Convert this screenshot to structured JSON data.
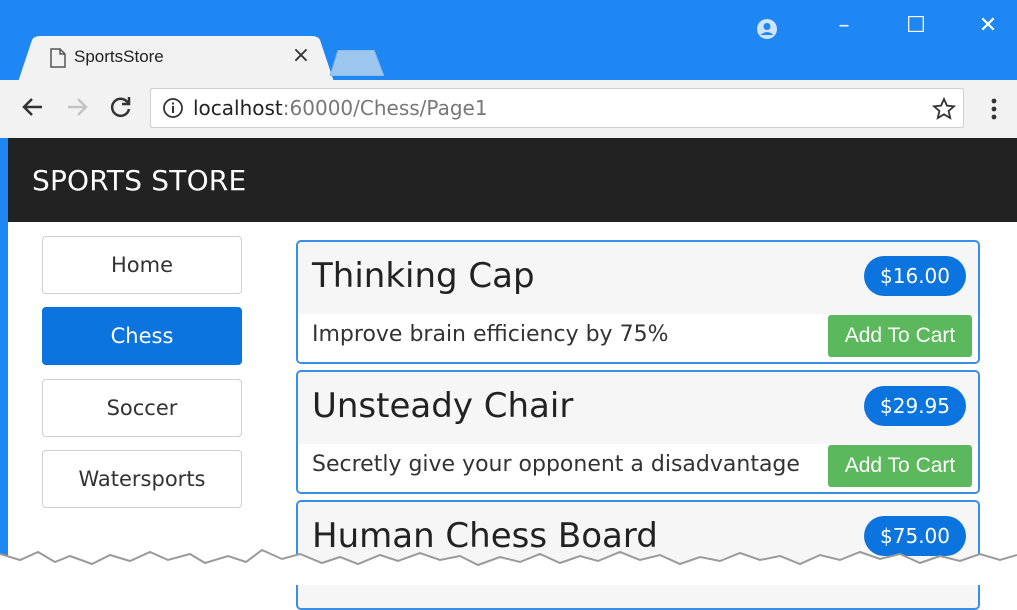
{
  "browser": {
    "tab_title": "SportsStore",
    "tab_close": "×",
    "url_host": "localhost",
    "url_path": ":60000/Chess/Page1",
    "window_controls": [
      "–",
      "☐",
      "✕"
    ]
  },
  "icons": {
    "tab": "document-icon",
    "back": "back-arrow-icon",
    "forward": "forward-arrow-icon",
    "reload": "reload-icon",
    "info": "info-icon",
    "star": "star-icon",
    "menu": "kebab-menu-icon",
    "account": "account-icon"
  },
  "colors": {
    "chrome_blue": "#1f87f3",
    "navbar": "#222222",
    "primary": "#0b74de",
    "success": "#5cb85c"
  },
  "store": {
    "brand": "SPORTS STORE",
    "categories": [
      {
        "label": "Home",
        "active": false
      },
      {
        "label": "Chess",
        "active": true
      },
      {
        "label": "Soccer",
        "active": false
      },
      {
        "label": "Watersports",
        "active": false
      }
    ],
    "products": [
      {
        "name": "Thinking Cap",
        "price": "$16.00",
        "description": "Improve brain efficiency by 75%",
        "cart_label": "Add To Cart"
      },
      {
        "name": "Unsteady Chair",
        "price": "$29.95",
        "description": "Secretly give your opponent a disadvantage",
        "cart_label": "Add To Cart"
      },
      {
        "name": "Human Chess Board",
        "price": "$75.00",
        "description": "",
        "cart_label": ""
      }
    ]
  }
}
